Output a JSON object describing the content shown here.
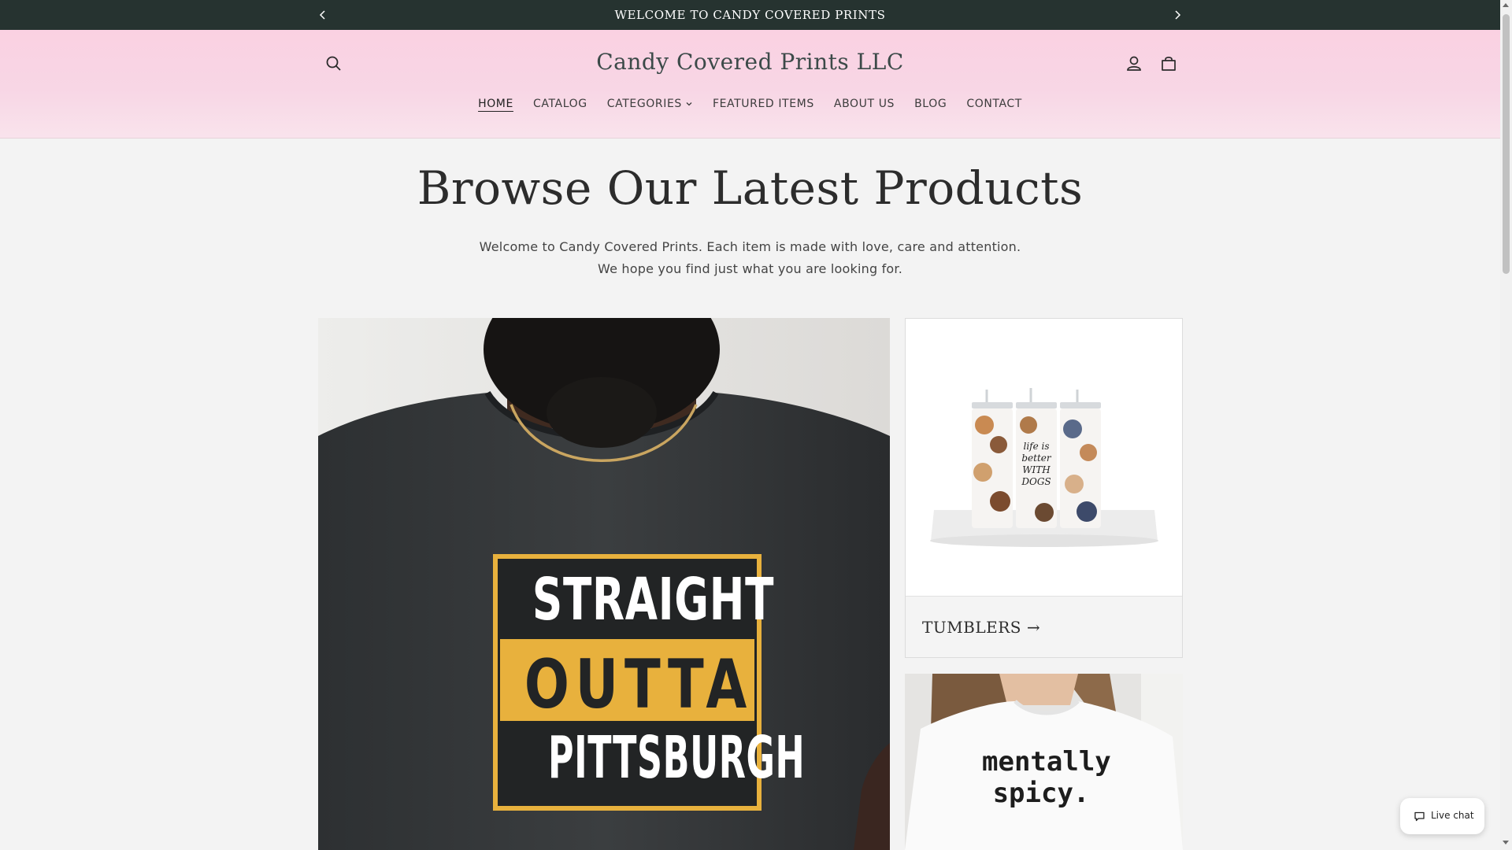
{
  "announcement": {
    "text": "WELCOME TO CANDY COVERED PRINTS"
  },
  "header": {
    "brand": "Candy Covered Prints LLC"
  },
  "nav": {
    "items": [
      {
        "label": "HOME",
        "active": true
      },
      {
        "label": "CATALOG"
      },
      {
        "label": "CATEGORIES",
        "dropdown": true
      },
      {
        "label": "FEATURED ITEMS"
      },
      {
        "label": "ABOUT US"
      },
      {
        "label": "BLOG"
      },
      {
        "label": "CONTACT"
      }
    ]
  },
  "hero": {
    "title": "Browse Our Latest Products",
    "subtitle_line1": "Welcome to Candy Covered Prints. Each item is made with love, care and attention.",
    "subtitle_line2": "We hope you find just what you are looking for."
  },
  "collections": {
    "main": {
      "shirt_lines": [
        "STRAIGHT",
        "OUTTA",
        "PITTSBURGH"
      ]
    },
    "tumblers": {
      "label": "TUMBLERS →",
      "print_text": "life is better WITH DOGS"
    },
    "sweatshirt": {
      "print_line1": "mentally",
      "print_line2": "spicy."
    }
  },
  "chat": {
    "label": "Live chat"
  },
  "colors": {
    "announcement_bg": "#263330",
    "header_pink": "#fad1e2",
    "page_bg": "#f3f3f3",
    "gold": "#e8b13d"
  },
  "icons": [
    "chevron-left-icon",
    "chevron-right-icon",
    "search-icon",
    "account-icon",
    "cart-icon",
    "chevron-down-icon",
    "chat-bubble-icon"
  ]
}
